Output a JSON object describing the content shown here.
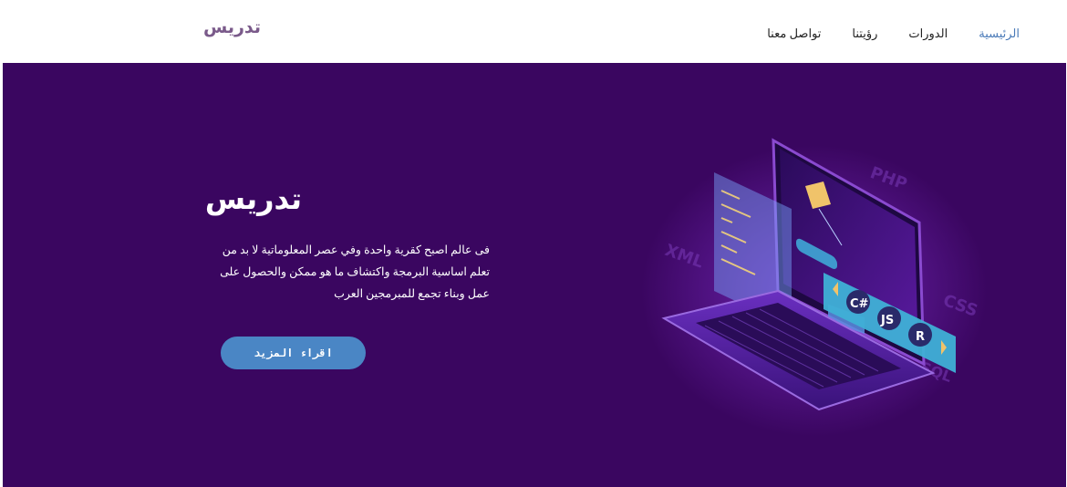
{
  "brand": "تدريس",
  "nav": {
    "items": [
      {
        "label": "الرئيسية",
        "active": true
      },
      {
        "label": "الدورات",
        "active": false
      },
      {
        "label": "رؤيتنا",
        "active": false
      },
      {
        "label": "تواصل معنا",
        "active": false
      }
    ]
  },
  "hero": {
    "title": "تدريس",
    "description": "فى عالم اصبح كقرية واحدة وفي عصر المعلوماتية لا بد من تعلم اساسية البرمجة واكتشاف ما هو ممكن والحصول على عمل وبناء تجمع للمبرمجين العرب",
    "cta_label": "اقراء المزيد",
    "illustration_labels": [
      "C#",
      "JS",
      "R",
      "PHP",
      "CSS",
      "XML",
      "SQL"
    ]
  },
  "colors": {
    "hero_bg": "#3a0660",
    "accent": "#4a86c5",
    "nav_active": "#4a7ab8",
    "brand": "#7a5a8a"
  }
}
